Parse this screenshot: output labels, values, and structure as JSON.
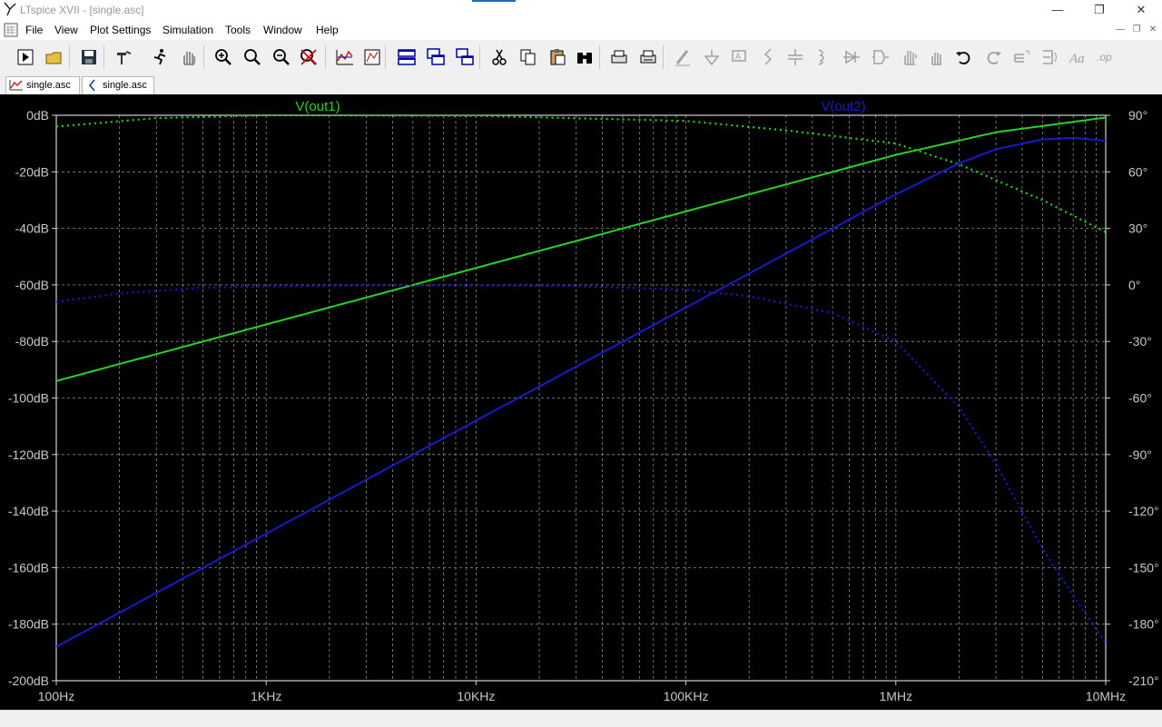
{
  "window": {
    "title": "LTspice XVII - [single.asc]",
    "minimize_glyph": "—",
    "maximize_glyph": "❐",
    "close_glyph": "✕"
  },
  "menu": {
    "items": [
      {
        "label": "File",
        "x": 28
      },
      {
        "label": "View",
        "x": 60
      },
      {
        "label": "Plot Settings",
        "x": 99
      },
      {
        "label": "Simulation",
        "x": 179
      },
      {
        "label": "Tools",
        "x": 248
      },
      {
        "label": "Window",
        "x": 290
      },
      {
        "label": "Help",
        "x": 348
      }
    ]
  },
  "tabs": [
    {
      "label": "single.asc",
      "icon": "waveform-icon"
    },
    {
      "label": "single.asc",
      "icon": "schematic-icon"
    }
  ],
  "toolbar": {
    "buttons": [
      "run-icon",
      "open-icon",
      "save-icon",
      "hammer-icon",
      "running-man-icon",
      "hand-icon",
      "zoom-in-icon",
      "zoom-full-icon",
      "zoom-out-icon",
      "cancel-zoom-icon",
      "autorange-icon",
      "waveform-window-icon",
      "tile-horizontal-icon",
      "tile-vertical-icon",
      "cascade-icon",
      "cut-icon",
      "copy-icon",
      "paste-icon",
      "find-icon",
      "print-setup-icon",
      "print-icon",
      "wire-icon",
      "ground-icon",
      "label-icon",
      "resistor-icon",
      "capacitor-icon",
      "inductor-icon",
      "diode-icon",
      "component-icon",
      "move-icon",
      "drag-icon",
      "undo-icon",
      "redo-icon",
      "rotate-icon",
      "mirror-icon",
      "text-icon",
      "spice-directive-icon"
    ]
  },
  "colors": {
    "plot_bg": "#000000",
    "grid": "#8c8c8c",
    "axis_text": "#c8c8c8",
    "trace_out1": "#27d227",
    "trace_out2": "#1a1acc"
  },
  "chart_data": {
    "type": "line",
    "xscale": "log",
    "xlim": [
      100,
      10000000
    ],
    "x_ticks": [
      "100Hz",
      "1KHz",
      "10KHz",
      "100KHz",
      "1MHz",
      "10MHz"
    ],
    "left_axis": {
      "ylim": [
        -200,
        0
      ],
      "ticks": [
        "0dB",
        "-20dB",
        "-40dB",
        "-60dB",
        "-80dB",
        "-100dB",
        "-120dB",
        "-140dB",
        "-160dB",
        "-180dB",
        "-200dB"
      ]
    },
    "right_axis": {
      "ylim": [
        -210,
        90
      ],
      "ticks": [
        "90°",
        "60°",
        "30°",
        "0°",
        "-30°",
        "-60°",
        "-90°",
        "-120°",
        "-150°",
        "-180°",
        "-210°"
      ]
    },
    "grid": true,
    "series": [
      {
        "name": "V(out1)",
        "magnitude": {
          "x": [
            100,
            1000,
            10000,
            100000,
            1000000,
            3000000,
            10000000
          ],
          "y": [
            -94,
            -74,
            -54,
            -34,
            -14,
            -6,
            -0.8
          ]
        },
        "phase": {
          "x": [
            100,
            300,
            1000,
            10000,
            100000,
            300000,
            1000000,
            2000000,
            5000000,
            10000000
          ],
          "y": [
            84,
            88.5,
            90,
            89.7,
            87,
            82,
            75,
            64,
            45,
            28
          ]
        }
      },
      {
        "name": "V(out2)",
        "magnitude": {
          "x": [
            100,
            1000,
            10000,
            100000,
            1000000,
            2000000,
            3000000,
            5000000,
            7000000,
            10000000
          ],
          "y": [
            -188,
            -148,
            -108,
            -68,
            -28,
            -17,
            -12,
            -8.5,
            -8,
            -9
          ]
        },
        "phase": {
          "x": [
            100,
            200,
            500,
            1000,
            3000,
            10000,
            30000,
            100000,
            200000,
            500000,
            1000000,
            2000000,
            3000000,
            5000000,
            7000000,
            10000000
          ],
          "y": [
            -9,
            -4.5,
            -1.5,
            -0.8,
            -0.3,
            -0.3,
            -0.6,
            -2.5,
            -6,
            -15,
            -30,
            -65,
            -95,
            -140,
            -165,
            -190
          ]
        }
      }
    ]
  }
}
